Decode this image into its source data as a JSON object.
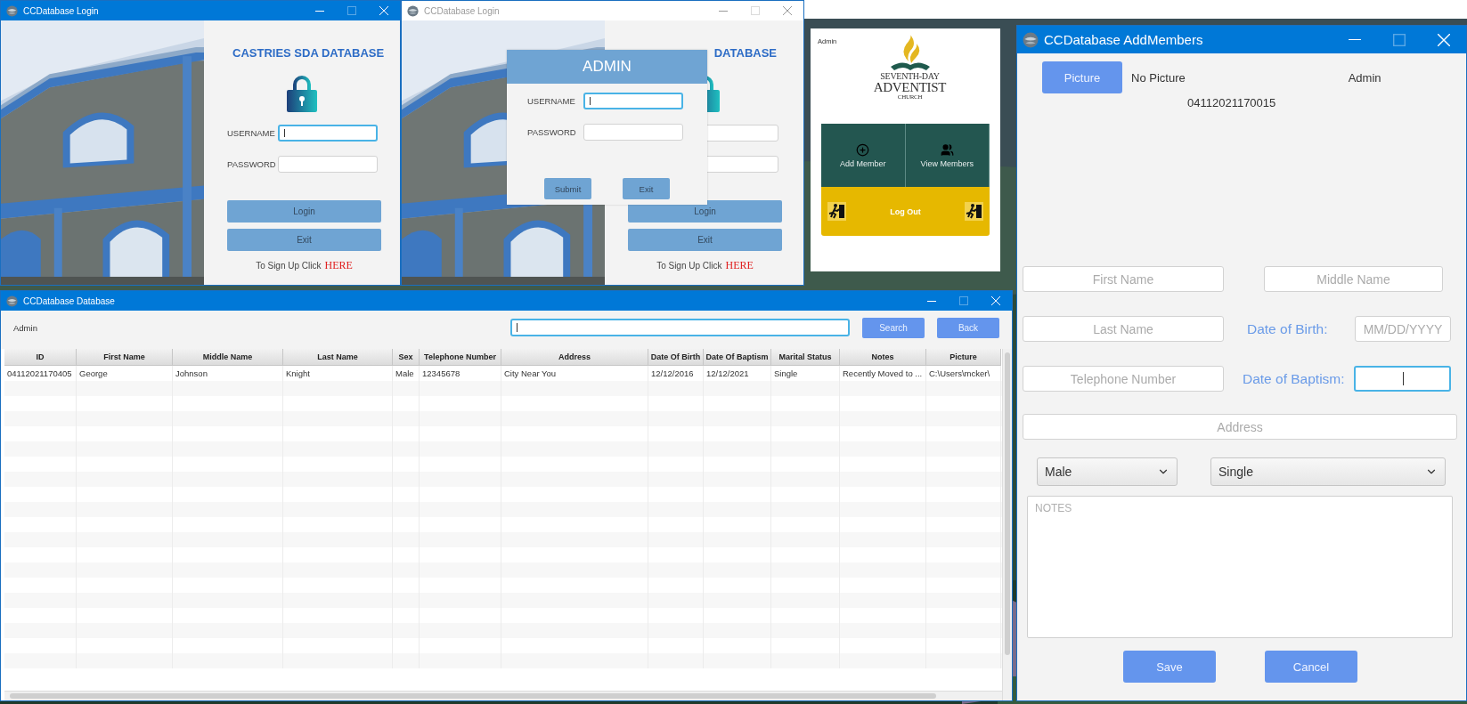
{
  "login_window": {
    "title": "CCDatabase Login",
    "active": true,
    "heading": "CASTRIES SDA DATABASE",
    "fields": [
      {
        "label": "USERNAME",
        "focused": true
      },
      {
        "label": "PASSWORD",
        "focused": false
      }
    ],
    "buttons": [
      "Login",
      "Exit"
    ],
    "signup_text": "To Sign Up Click",
    "signup_link": "HERE"
  },
  "login_window_2": {
    "title": "CCDatabase Login",
    "active": false,
    "heading": "DATABASE",
    "buttons": [
      "Login",
      "Exit"
    ],
    "signup_text": "To Sign Up Click",
    "signup_link": "HERE"
  },
  "admin_dialog": {
    "title": "ADMIN",
    "fields": [
      {
        "label": "USERNAME",
        "focused": true
      },
      {
        "label": "PASSWORD",
        "focused": false
      }
    ],
    "buttons": [
      "Submit",
      "Exit"
    ]
  },
  "menu_window": {
    "user": "Admin",
    "logo_lines": [
      "SEVENTH-DAY",
      "ADVENTIST",
      "CHURCH"
    ],
    "tiles": [
      {
        "kind": "add",
        "label": "Add Member"
      },
      {
        "kind": "view",
        "label": "View Members"
      },
      {
        "kind": "logout",
        "label": "Log Out"
      }
    ]
  },
  "database_window": {
    "title": "CCDatabase Database",
    "active": true,
    "user": "Admin",
    "search": {
      "focused": true
    },
    "buttons": [
      "Search",
      "Back"
    ],
    "table": {
      "columns": [
        "ID",
        "First Name",
        "Middle Name",
        "Last Name",
        "Sex",
        "Telephone Number",
        "Address",
        "Date Of Birth",
        "Date Of Baptism",
        "Marital Status",
        "Notes",
        "Picture"
      ],
      "rows": [
        [
          "04112021170405",
          "George",
          "Johnson",
          "Knight",
          "Male",
          "12345678",
          "City Near You",
          "12/12/2016",
          "12/12/2021",
          "Single",
          "Recently Moved to ...",
          "C:\\Users\\mcker\\"
        ]
      ]
    }
  },
  "add_members_window": {
    "title": "CCDatabase AddMembers",
    "active": true,
    "picture_button": "Picture",
    "picture_status": "No Picture",
    "user": "Admin",
    "member_id": "04112021170015",
    "first_name": {
      "placeholder": "First Name",
      "focused": false
    },
    "middle_name": {
      "placeholder": "Middle Name",
      "focused": false
    },
    "last_name": {
      "placeholder": "Last Name",
      "focused": false
    },
    "date_of_birth": {
      "label": "Date of Birth:",
      "placeholder": "MM/DD/YYYY",
      "focused": false
    },
    "telephone": {
      "placeholder": "Telephone Number",
      "focused": false
    },
    "date_of_baptism": {
      "label": "Date of Baptism:",
      "focused": true
    },
    "address": {
      "placeholder": "Address",
      "focused": false
    },
    "sex": {
      "value": "Male"
    },
    "marital_status": {
      "value": "Single"
    },
    "notes": {
      "placeholder": "NOTES",
      "focused": false
    },
    "buttons": [
      "Save",
      "Cancel"
    ]
  }
}
